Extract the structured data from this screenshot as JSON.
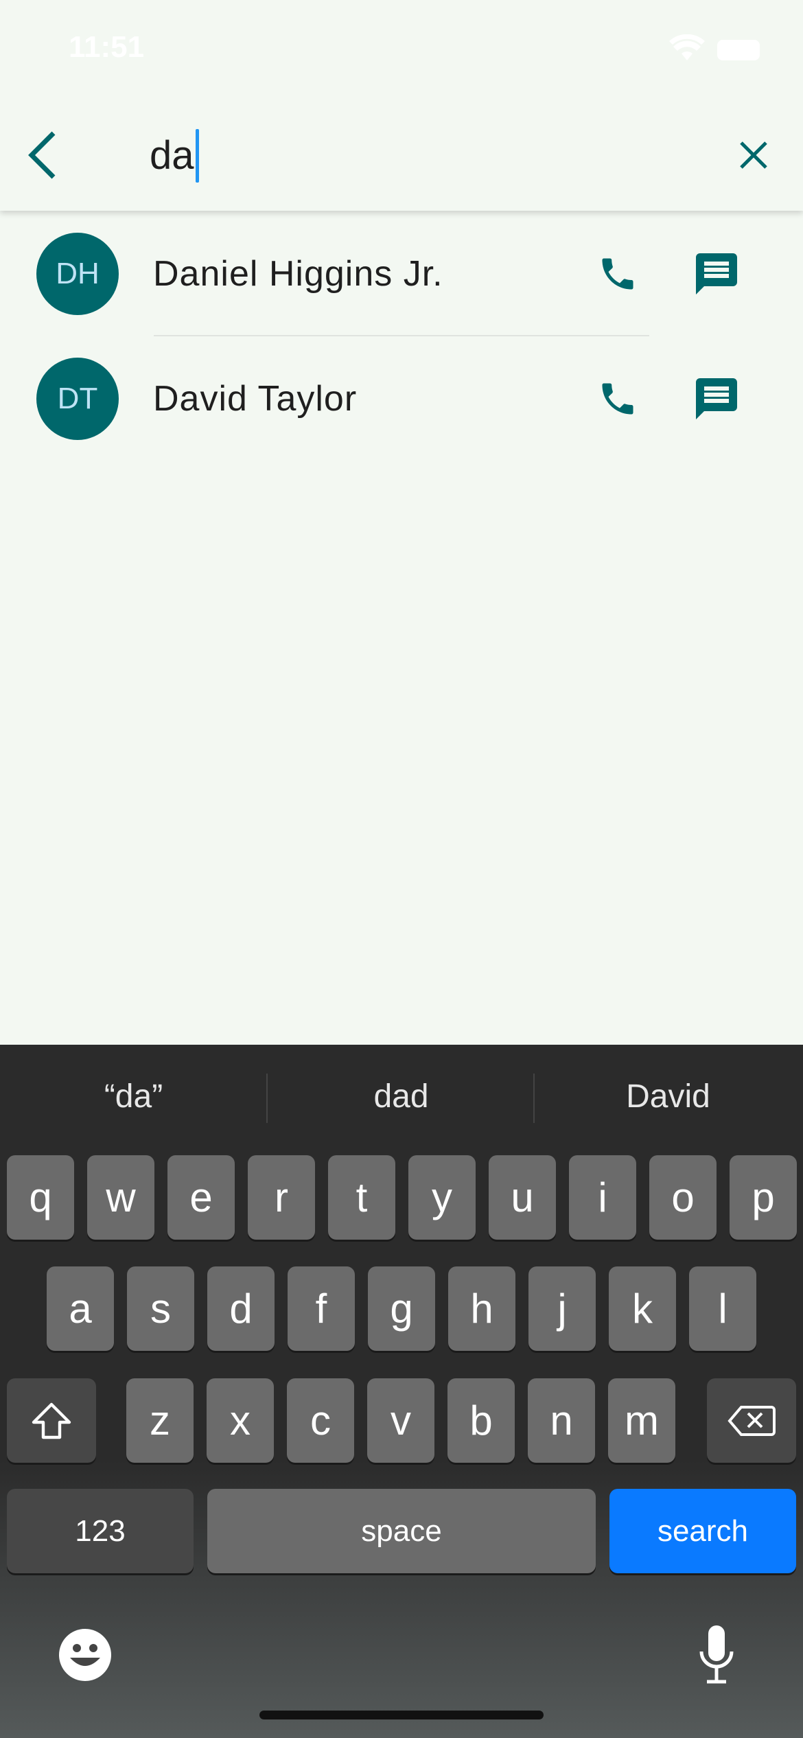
{
  "status_bar": {
    "time": "11:51"
  },
  "search": {
    "query": "da"
  },
  "contacts": [
    {
      "initials": "DH",
      "name": "Daniel Higgins Jr."
    },
    {
      "initials": "DT",
      "name": "David Taylor"
    }
  ],
  "keyboard": {
    "suggestions": [
      "“da”",
      "dad",
      "David"
    ],
    "row1": [
      "q",
      "w",
      "e",
      "r",
      "t",
      "y",
      "u",
      "i",
      "o",
      "p"
    ],
    "row2": [
      "a",
      "s",
      "d",
      "f",
      "g",
      "h",
      "j",
      "k",
      "l"
    ],
    "row3": [
      "z",
      "x",
      "c",
      "v",
      "b",
      "n",
      "m"
    ],
    "numbers_label": "123",
    "space_label": "space",
    "search_label": "search"
  },
  "colors": {
    "accent": "#00676b",
    "search_key": "#0a7aff",
    "caret": "#2196f3"
  }
}
